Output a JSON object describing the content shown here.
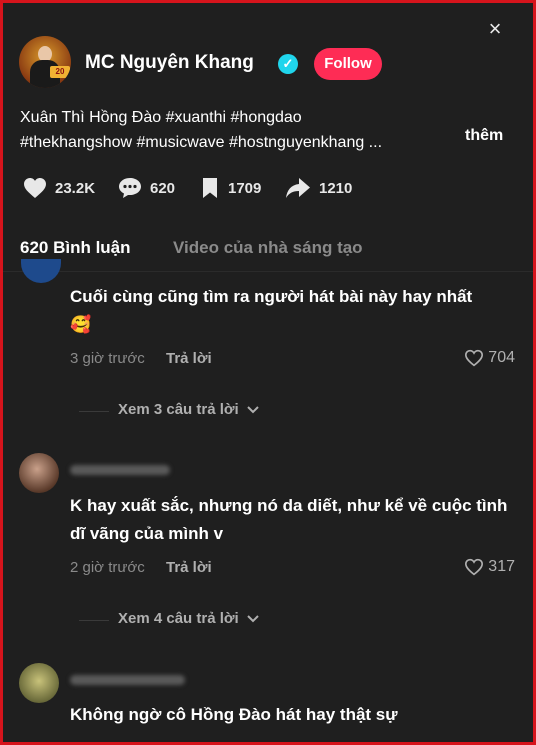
{
  "header": {
    "author": "MC Nguyên Khang",
    "follow_label": "Follow",
    "close_glyph": "×",
    "avatar_tag": "20"
  },
  "caption": {
    "line1": "Xuân Thì Hồng Đào #xuanthi #hongdao",
    "line2": "#thekhangshow #musicwave #hostnguyenkhang ...",
    "more_label": "thêm"
  },
  "stats": {
    "likes": "23.2K",
    "comments": "620",
    "saves": "1709",
    "shares": "1210"
  },
  "tabs": {
    "comments_tab": "620 Bình luận",
    "creator_tab": "Video của nhà sáng tạo"
  },
  "comments": [
    {
      "text": "Cuối cùng cũng tìm ra người hát bài này hay nhất",
      "emoji": "🥰",
      "time": "3 giờ trước",
      "reply_label": "Trả lời",
      "likes": "704",
      "view_replies": "Xem 3 câu trả lời"
    },
    {
      "text": "K hay xuất sắc, nhưng nó da diết, như kể về cuộc tình dĩ vãng của mình v",
      "time": "2 giờ trước",
      "reply_label": "Trả lời",
      "likes": "317",
      "view_replies": "Xem 4 câu trả lời"
    },
    {
      "text": "Không ngờ cô Hồng Đào hát hay thật sự"
    }
  ],
  "colors": {
    "accent": "#fe2c55",
    "verified": "#20d5ec",
    "background": "#1f1f1f",
    "border": "#d6141c"
  },
  "icons": [
    "close-icon",
    "verified-icon",
    "heart-icon",
    "comment-icon",
    "bookmark-icon",
    "share-icon",
    "chevron-down-icon"
  ]
}
